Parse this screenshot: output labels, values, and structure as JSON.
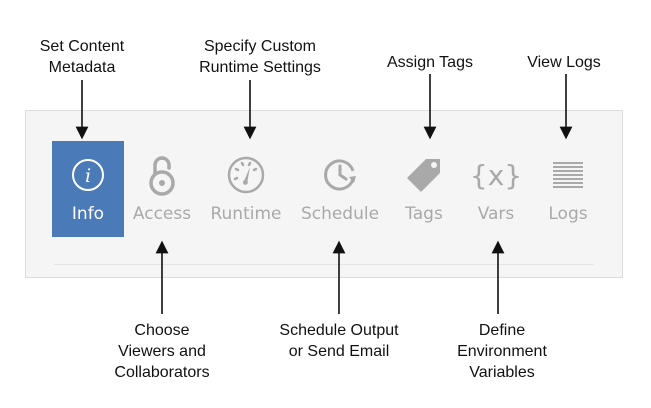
{
  "callouts": {
    "set_content_metadata": [
      "Set Content",
      "Metadata"
    ],
    "custom_runtime": [
      "Specify Custom",
      "Runtime Settings"
    ],
    "assign_tags": [
      "Assign Tags"
    ],
    "view_logs": [
      "View Logs"
    ],
    "choose_viewers": [
      "Choose",
      "Viewers and",
      "Collaborators"
    ],
    "schedule_output": [
      "Schedule Output",
      "or Send Email"
    ],
    "define_vars": [
      "Define",
      "Environment",
      "Variables"
    ]
  },
  "tabs": [
    {
      "label": "Info",
      "icon": "info-icon",
      "active": true
    },
    {
      "label": "Access",
      "icon": "padlock-icon",
      "active": false
    },
    {
      "label": "Runtime",
      "icon": "gauge-icon",
      "active": false
    },
    {
      "label": "Schedule",
      "icon": "clock-icon",
      "active": false
    },
    {
      "label": "Tags",
      "icon": "tag-icon",
      "active": false
    },
    {
      "label": "Vars",
      "icon": "braces-x-icon",
      "active": false
    },
    {
      "label": "Logs",
      "icon": "lines-icon",
      "active": false
    }
  ],
  "colors": {
    "active_bg": "#4a7ab8",
    "inactive_icon": "#a9a9a9",
    "panel_bg": "#f5f5f5"
  }
}
